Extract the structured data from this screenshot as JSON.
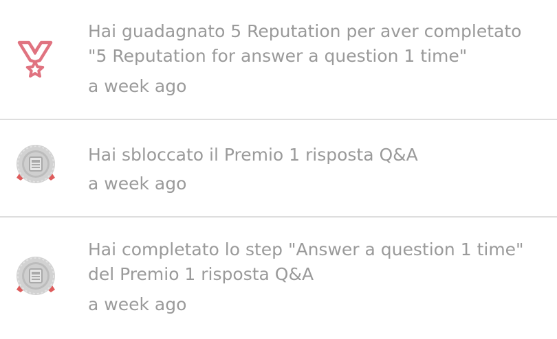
{
  "notifications": [
    {
      "icon": "reputation-medal-icon",
      "message": "Hai guadagnato 5 Reputation per aver completato \"5 Reputation for answer a question 1 time\"",
      "time": "a week ago"
    },
    {
      "icon": "award-badge-icon",
      "message": "Hai sbloccato il Premio 1 risposta Q&A",
      "time": "a week ago"
    },
    {
      "icon": "award-badge-icon",
      "message": "Hai completato lo step \"Answer a question 1 time\" del Premio 1 risposta Q&A",
      "time": "a week ago"
    }
  ],
  "colors": {
    "text": "#9a9a9a",
    "divider": "#dedede",
    "medal_pink": "#e07380",
    "badge_gray": "#c8c8c8",
    "ribbon_red": "#de5b5b"
  }
}
